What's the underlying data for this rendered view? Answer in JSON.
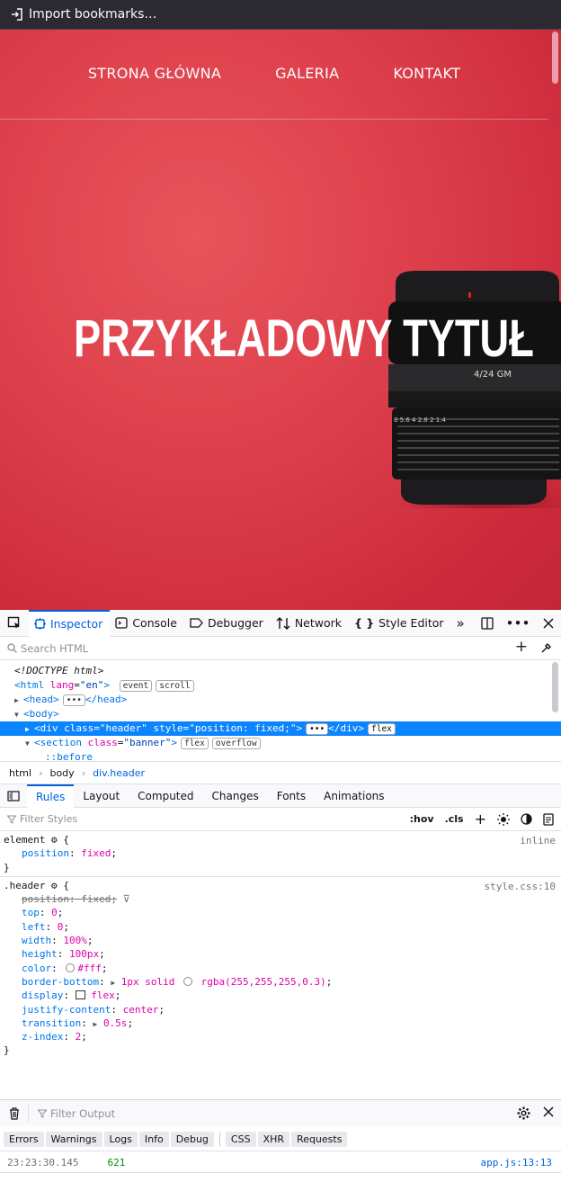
{
  "bookmarks_bar": {
    "import_label": "Import bookmarks…"
  },
  "page": {
    "nav": [
      "STRONA GŁÓWNA",
      "GALERIA",
      "KONTAKT"
    ],
    "hero_title": "PRZYKŁADOWY TYTUŁ",
    "lens_text": "4/24 GM",
    "lens_scale": "8  5.6  4  2.8  2  1.4"
  },
  "devtools": {
    "tabs": [
      "Inspector",
      "Console",
      "Debugger",
      "Network",
      "Style Editor"
    ],
    "search_placeholder": "Search HTML",
    "markup": {
      "doctype": "<!DOCTYPE html>",
      "html_open": "<html",
      "html_attr": "lang",
      "html_val": "\"en\"",
      "html_close": ">",
      "badge_event": "event",
      "badge_scroll": "scroll",
      "head": "<head>",
      "head_close": "</head>",
      "body": "<body>",
      "div_open": "<div",
      "div_class_attr": "class",
      "div_class_val": "\"header\"",
      "div_style_attr": "style",
      "div_style_val": "\"position: fixed;\"",
      "div_close": "</div>",
      "badge_flex": "flex",
      "section_open": "<section",
      "section_attr": "class",
      "section_val": "\"banner\"",
      "badge_overflow": "overflow",
      "before": "::before"
    },
    "breadcrumbs": [
      "html",
      "body",
      "div.header"
    ],
    "rule_tabs": [
      "Rules",
      "Layout",
      "Computed",
      "Changes",
      "Fonts",
      "Animations"
    ],
    "filter_placeholder": "Filter Styles",
    "hov": ":hov",
    "cls": ".cls",
    "rules": {
      "element_selector": "element",
      "element_source": "inline",
      "element_prop": "position",
      "element_val": "fixed",
      "header_selector": ".header",
      "header_source": "style.css:10",
      "props": [
        {
          "name": "position",
          "value": "fixed"
        },
        {
          "name": "top",
          "value": "0"
        },
        {
          "name": "left",
          "value": "0"
        },
        {
          "name": "width",
          "value": "100%"
        },
        {
          "name": "height",
          "value": "100px"
        },
        {
          "name": "color",
          "value": "#fff"
        },
        {
          "name": "border-bottom",
          "value": "1px solid rgba(255,255,255,0.3)"
        },
        {
          "name": "display",
          "value": "flex"
        },
        {
          "name": "justify-content",
          "value": "center"
        },
        {
          "name": "transition",
          "value": "0.5s"
        },
        {
          "name": "z-index",
          "value": "2"
        }
      ]
    },
    "console": {
      "filter_placeholder": "Filter Output",
      "filters": [
        "Errors",
        "Warnings",
        "Logs",
        "Info",
        "Debug",
        "CSS",
        "XHR",
        "Requests"
      ],
      "line": {
        "timestamp": "23:23:30.145",
        "value": "621",
        "source": "app.js:13:13"
      }
    }
  },
  "colors": {
    "accent": "#0061e0",
    "selected": "#0a84ff",
    "hero_bg": "#dc3e4a"
  }
}
